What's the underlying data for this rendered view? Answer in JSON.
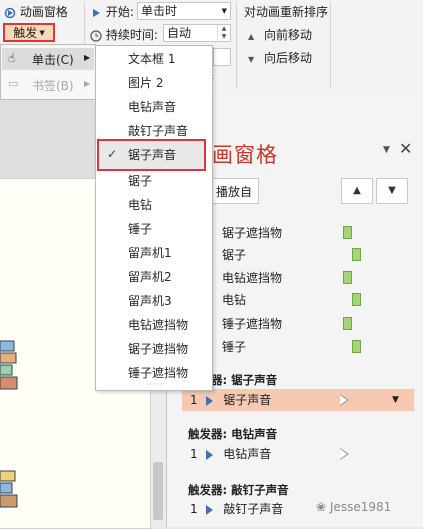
{
  "ribbon": {
    "anim_pane_label": "动画窗格",
    "trigger_label": "触发",
    "start_label": "开始:",
    "start_value": "单击时",
    "duration_label": "持续时间:",
    "duration_value": "自动",
    "reorder_title": "对动画重新排序",
    "move_earlier": "向前移动",
    "move_later": "向后移动",
    "group_tail": "时"
  },
  "submenu": {
    "on_click": "单击(C)",
    "bookmark": "书签(B)"
  },
  "menu": {
    "items": [
      "文本框 1",
      "图片 2",
      "电钻声音",
      "敲钉子声音",
      "锯子声音",
      "锯子",
      "电钻",
      "锤子",
      "留声机1",
      "留声机2",
      "留声机3",
      "电钻遮挡物",
      "锯子遮挡物",
      "锤子遮挡物"
    ],
    "checked_item": "锯子声音"
  },
  "pane": {
    "title": "动画窗格",
    "play_label": "播放自",
    "animations": [
      "锯子遮挡物",
      "锯子",
      "电钻遮挡物",
      "电钻",
      "锤子遮挡物",
      "锤子"
    ],
    "sections": [
      {
        "title": "触发器: 锯子声音",
        "number": "1",
        "item": "锯子声音",
        "selected": true
      },
      {
        "title": "触发器: 电钻声音",
        "number": "1",
        "item": "电钻声音",
        "selected": false
      },
      {
        "title": "触发器: 敲钉子声音",
        "number": "1",
        "item": "敲钉子声音",
        "selected": false
      }
    ]
  },
  "watermark": "Jesse1981",
  "colors": {
    "highlight_border": "#d9373a",
    "selected_row": "#f7c9b0",
    "bar_green": "#a6d479",
    "pane_title": "#c0392b"
  }
}
